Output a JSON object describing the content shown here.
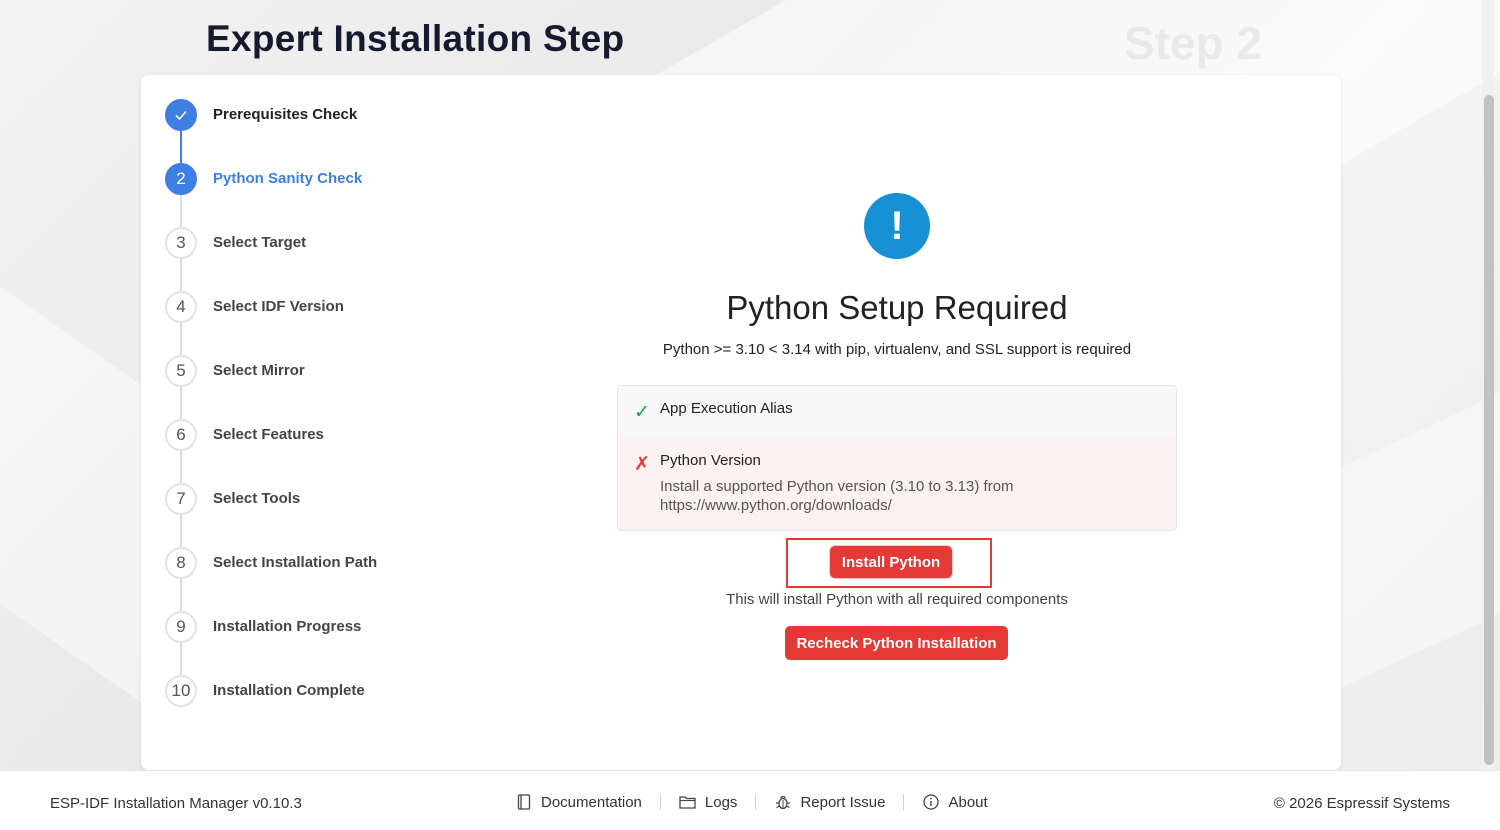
{
  "header": {
    "title": "Expert Installation Step",
    "step_watermark": "Step 2"
  },
  "steps": [
    {
      "number": "1",
      "label": "Prerequisites Check",
      "state": "done"
    },
    {
      "number": "2",
      "label": "Python Sanity Check",
      "state": "active"
    },
    {
      "number": "3",
      "label": "Select Target",
      "state": "pending"
    },
    {
      "number": "4",
      "label": "Select IDF Version",
      "state": "pending"
    },
    {
      "number": "5",
      "label": "Select Mirror",
      "state": "pending"
    },
    {
      "number": "6",
      "label": "Select Features",
      "state": "pending"
    },
    {
      "number": "7",
      "label": "Select Tools",
      "state": "pending"
    },
    {
      "number": "8",
      "label": "Select Installation Path",
      "state": "pending"
    },
    {
      "number": "9",
      "label": "Installation Progress",
      "state": "pending"
    },
    {
      "number": "10",
      "label": "Installation Complete",
      "state": "pending"
    }
  ],
  "main": {
    "icon": "exclamation-icon",
    "title": "Python Setup Required",
    "subtitle": "Python >= 3.10 < 3.14 with pip, virtualenv, and SSL support is required"
  },
  "checks": {
    "alias": {
      "mark": "✓",
      "name": "App Execution Alias"
    },
    "version": {
      "mark": "✗",
      "name": "Python Version",
      "detail_line1": "Install a supported Python version (3.10 to 3.13) from",
      "detail_line2": "https://www.python.org/downloads/"
    }
  },
  "actions": {
    "install_label": "Install Python",
    "install_note": "This will install Python with all required components",
    "recheck_label": "Recheck Python Installation"
  },
  "footer": {
    "app_version": "ESP-IDF Installation Manager v0.10.3",
    "links": {
      "documentation": "Documentation",
      "logs": "Logs",
      "report_issue": "Report Issue",
      "about": "About"
    },
    "copyright": "© 2026 Espressif Systems"
  },
  "colors": {
    "accent_blue": "#3d7fe3",
    "warning_blue": "#1890d5",
    "danger_red": "#e53935",
    "success_green": "#1aa34a"
  }
}
